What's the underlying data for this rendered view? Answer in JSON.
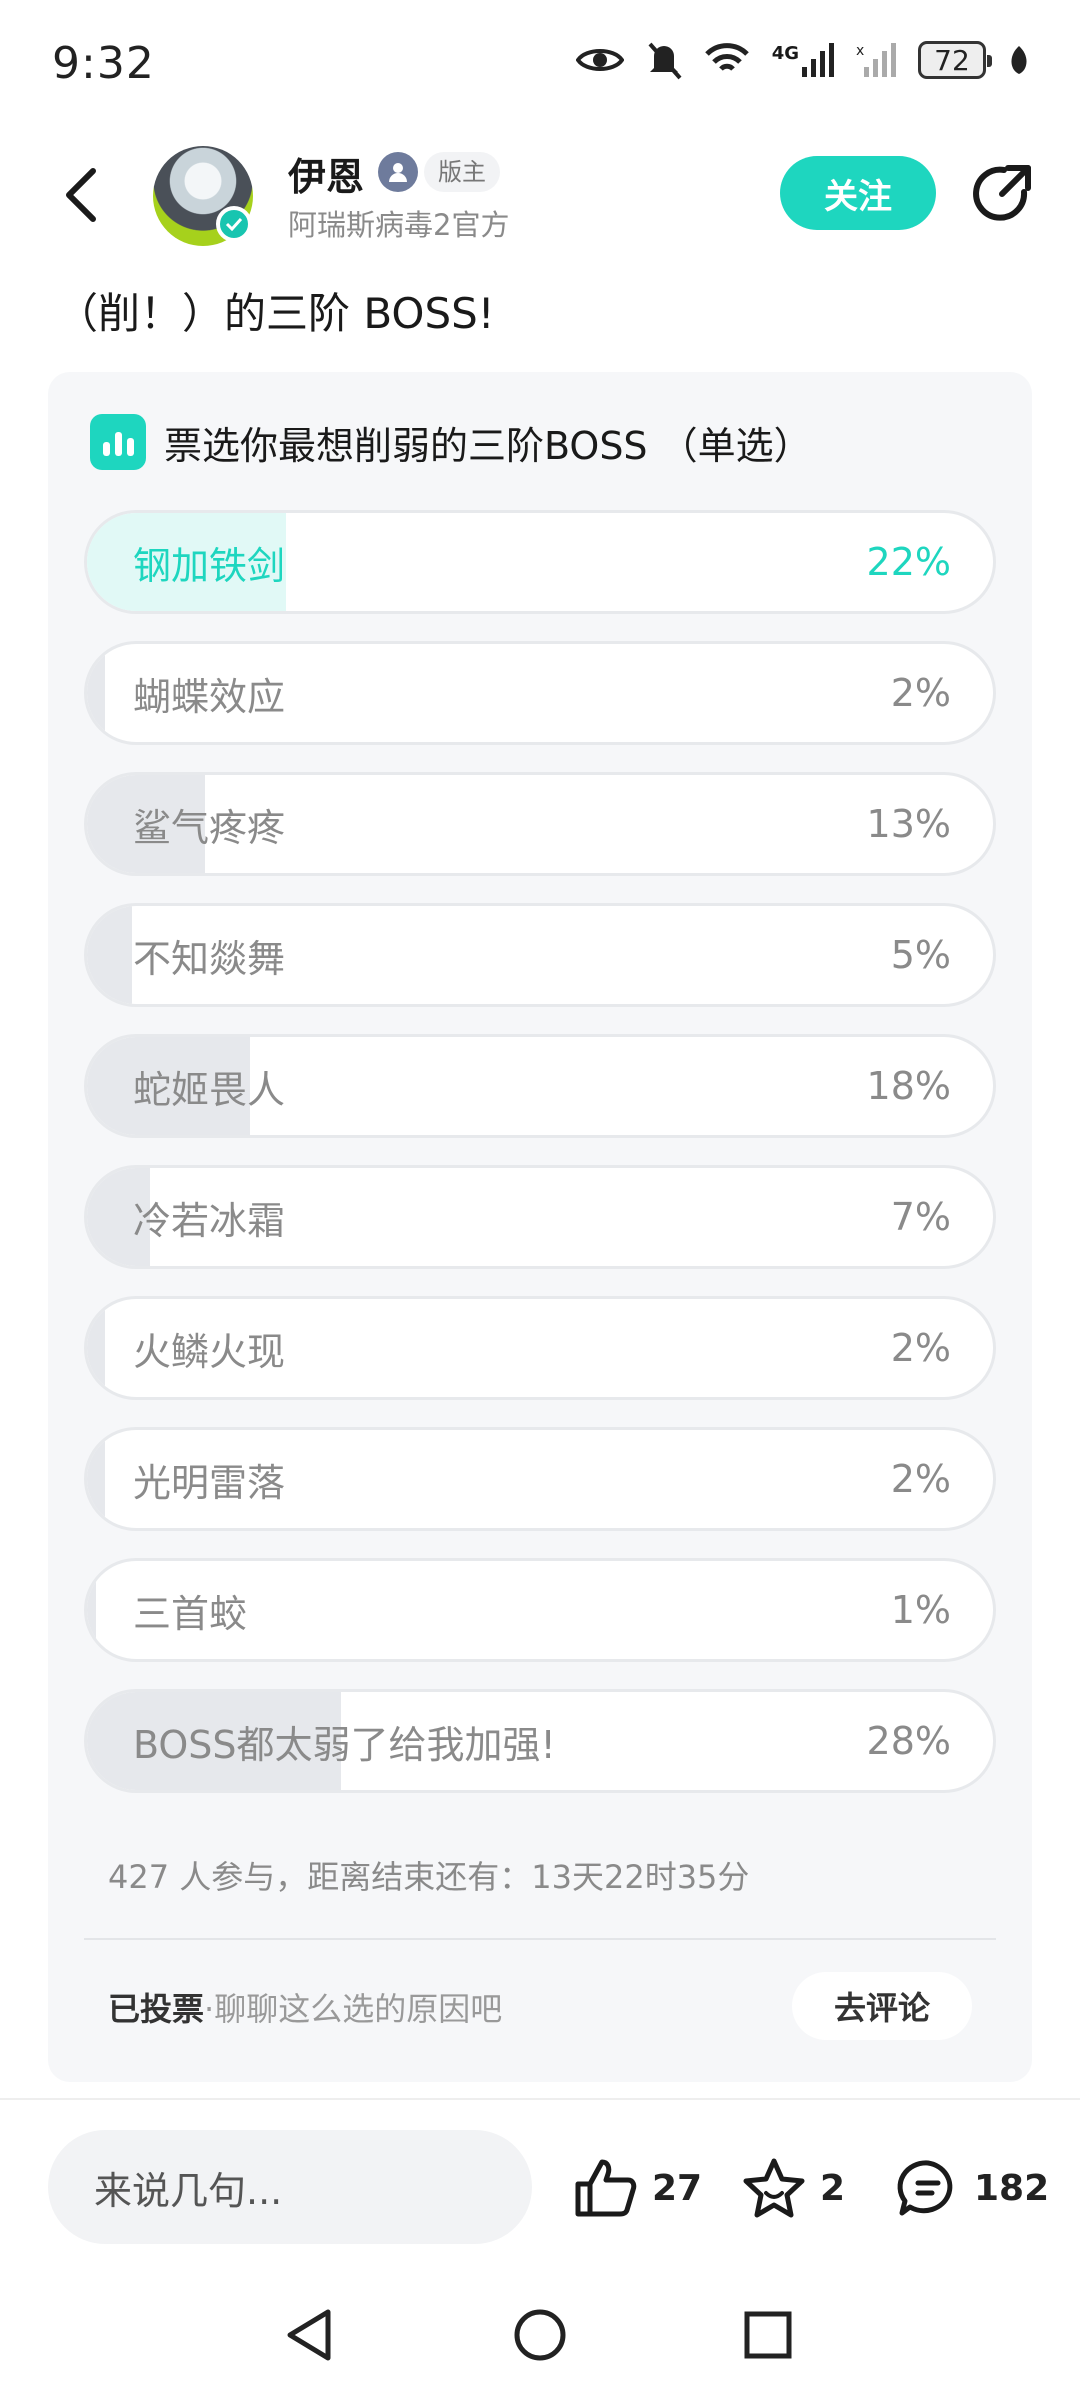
{
  "status_bar": {
    "time": "9:32",
    "network": "4G",
    "battery": "72"
  },
  "header": {
    "user_name": "伊恩",
    "role_badge": "版主",
    "subtitle": "阿瑞斯病毒2官方",
    "follow_label": "关注"
  },
  "post": {
    "text": "（削！）的三阶 BOSS!"
  },
  "poll": {
    "title": "票选你最想削弱的三阶BOSS （单选）",
    "options": [
      {
        "label": "钢加铁剑",
        "percent": "22%",
        "value": 22,
        "selected": true
      },
      {
        "label": "蝴蝶效应",
        "percent": "2%",
        "value": 2,
        "selected": false
      },
      {
        "label": "鲨气疼疼",
        "percent": "13%",
        "value": 13,
        "selected": false
      },
      {
        "label": "不知燚舞",
        "percent": "5%",
        "value": 5,
        "selected": false
      },
      {
        "label": "蛇姬畏人",
        "percent": "18%",
        "value": 18,
        "selected": false
      },
      {
        "label": "冷若冰霜",
        "percent": "7%",
        "value": 7,
        "selected": false
      },
      {
        "label": "火鳞火现",
        "percent": "2%",
        "value": 2,
        "selected": false
      },
      {
        "label": "光明雷落",
        "percent": "2%",
        "value": 2,
        "selected": false
      },
      {
        "label": "三首蛟",
        "percent": "1%",
        "value": 1,
        "selected": false
      },
      {
        "label": "BOSS都太弱了给我加强!",
        "percent": "28%",
        "value": 28,
        "selected": false
      }
    ],
    "stats": "427 人参与，距离结束还有：13天22时35分",
    "voted_label": "已投票",
    "voted_hint": "·聊聊这么选的原因吧",
    "comment_button": "去评论"
  },
  "bottom_bar": {
    "input_placeholder": "来说几句...",
    "like_count": "27",
    "favorite_count": "2",
    "comment_count": "182"
  },
  "colors": {
    "accent": "#1ed6bf",
    "bar_fill": "#e6e8ec",
    "selected_fill": "#e1f9f6",
    "card_bg": "#f6f7f9"
  },
  "icons": [
    "back-arrow-icon",
    "verified-icon",
    "user-badge-icon",
    "share-icon",
    "poll-chart-icon",
    "like-icon",
    "star-icon",
    "comment-icon",
    "eye-icon",
    "mute-bell-icon",
    "wifi-icon",
    "signal-icon",
    "leaf-icon"
  ]
}
